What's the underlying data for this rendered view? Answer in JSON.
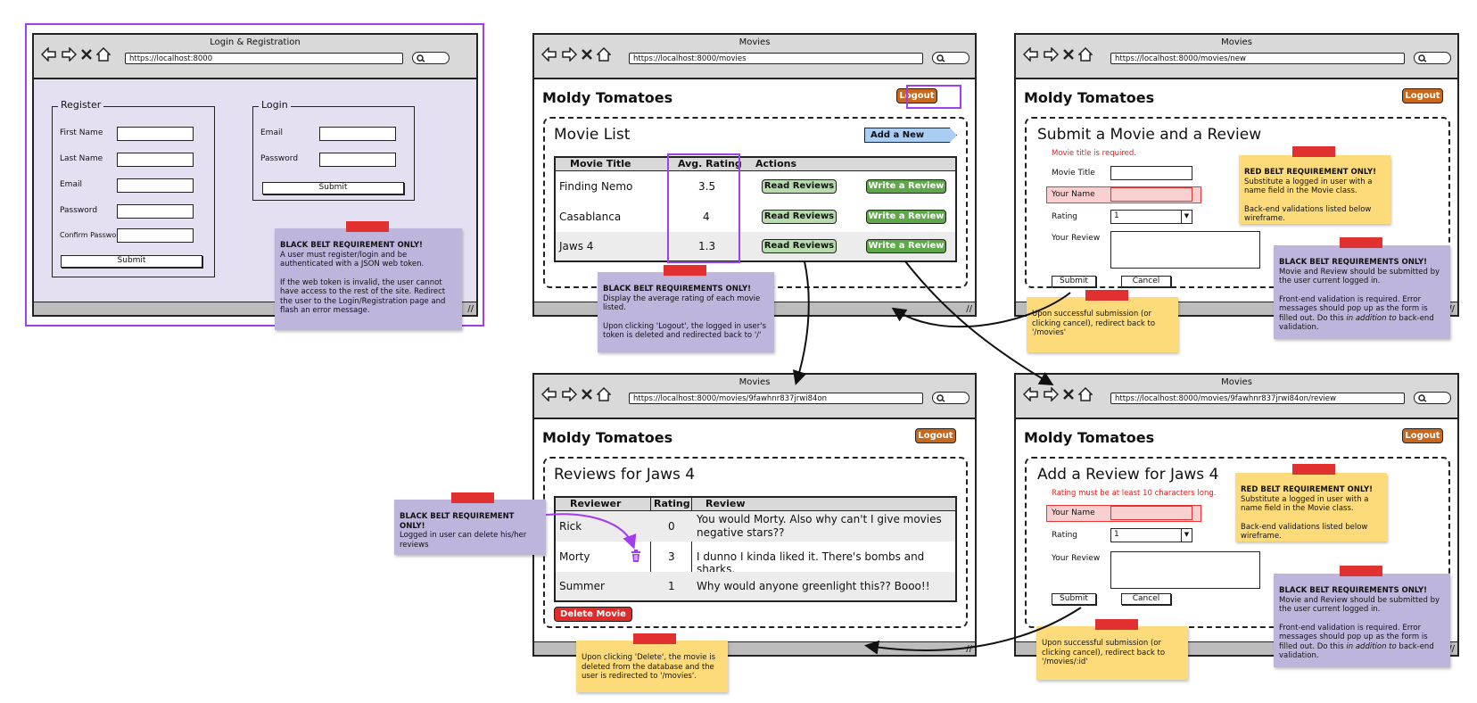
{
  "login_window": {
    "title": "Login & Registration",
    "url": "https://localhost:8000",
    "register": {
      "legend": "Register",
      "fields": [
        "First Name",
        "Last Name",
        "Email",
        "Password",
        "Confirm Password"
      ],
      "submit": "Submit"
    },
    "login": {
      "legend": "Login",
      "fields": [
        "Email",
        "Password"
      ],
      "submit": "Submit"
    },
    "note": {
      "heading": "BLACK BELT REQUIREMENT ONLY!",
      "p1": "A user must register/login and be authenticated with a JSON web token.",
      "p2": "If the web token is invalid, the user cannot have access to the rest of the site. Redirect the user to the Login/Registration page and flash an error message."
    }
  },
  "movies_window": {
    "title": "Movies",
    "url": "https://localhost:8000/movies",
    "brand": "Moldy Tomatoes",
    "logout": "Logout",
    "heading": "Movie List",
    "add_button": "Add a New Movie",
    "columns": [
      "Movie Title",
      "Avg. Rating",
      "Actions"
    ],
    "rows": [
      {
        "title": "Finding Nemo",
        "rating": "3.5"
      },
      {
        "title": "Casablanca",
        "rating": "4"
      },
      {
        "title": "Jaws 4",
        "rating": "1.3"
      }
    ],
    "read_label": "Read Reviews",
    "write_label": "Write a Review",
    "note": {
      "heading": "BLACK BELT REQUIREMENTS ONLY!",
      "p1": "Display the average rating of each movie listed.",
      "p2": "Upon clicking 'Logout', the logged in user's token is deleted and redirected back to '/'"
    }
  },
  "new_window": {
    "title": "Movies",
    "url": "https://localhost:8000/movies/new",
    "brand": "Moldy Tomatoes",
    "logout": "Logout",
    "heading": "Submit a Movie and a Review",
    "error": "Movie title is required.",
    "labels": {
      "movie_title": "Movie Title",
      "your_name": "Your Name",
      "rating": "Rating",
      "your_review": "Your Review"
    },
    "rating_value": "1",
    "submit": "Submit",
    "cancel": "Cancel",
    "red_note": {
      "heading": "RED BELT REQUIREMENT ONLY!",
      "p1": "Substitute a logged in user with a name field in the Movie class.",
      "p2": "Back-end validations listed below wireframe."
    },
    "black_note": {
      "heading": "BLACK BELT REQUIREMENTS ONLY!",
      "p1": "Movie and Review should be submitted by the user current logged in.",
      "p2a": "Front-end validation is required. Error messages should pop up  as the form is filled out. Do this ",
      "p2em": "in addition to",
      "p2b": " back-end validation."
    },
    "redirect_note": "Upon successful submission (or clicking cancel), redirect back to '/movies'"
  },
  "reviews_window": {
    "title": "Movies",
    "url": "https://localhost:8000/movies/9fawhnr837jrwi84on",
    "brand": "Moldy Tomatoes",
    "logout": "Logout",
    "heading": "Reviews for Jaws 4",
    "columns": [
      "Reviewer",
      "Rating",
      "Review"
    ],
    "rows": [
      {
        "reviewer": "Rick",
        "rating": "0",
        "review": "You would Morty. Also why can't I give movies negative stars??"
      },
      {
        "reviewer": "Morty",
        "rating": "3",
        "review": "I dunno I kinda liked it. There's bombs and sharks."
      },
      {
        "reviewer": "Summer",
        "rating": "1",
        "review": "Why would anyone greenlight this?? Booo!!"
      }
    ],
    "delete_button": "Delete Movie",
    "delete_note": "Upon clicking 'Delete', the movie is deleted from the database and the user is redirected to '/movies'.",
    "black_note": {
      "heading": "BLACK BELT REQUIREMENT ONLY!",
      "p1": "Logged in user can delete his/her reviews"
    },
    "trash_color": "#a23ef0"
  },
  "review_window": {
    "title": "Movies",
    "url": "https://localhost:8000/movies/9fawhnr837jrwi84on/review",
    "brand": "Moldy Tomatoes",
    "logout": "Logout",
    "heading": "Add a Review for Jaws 4",
    "error": "Rating must be at least 10 characters long.",
    "labels": {
      "your_name": "Your Name",
      "rating": "Rating",
      "your_review": "Your Review"
    },
    "rating_value": "1",
    "submit": "Submit",
    "cancel": "Cancel",
    "red_note": {
      "heading": "RED BELT REQUIREMENT ONLY!",
      "p1": "Substitute a logged in user with a name field in the Movie class.",
      "p2": "Back-end validations listed below wireframe."
    },
    "black_note": {
      "heading": "BLACK BELT REQUIREMENTS ONLY!",
      "p1": "Movie and Review should be submitted by the user current logged in.",
      "p2a": "Front-end validation is required. Error messages should pop up  as the form is filled out. Do this ",
      "p2em": "in addition to",
      "p2b": " back-end validation."
    },
    "redirect_note": "Upon successful submission (or clicking cancel), redirect back to '/movies/:id'"
  },
  "colors": {
    "highlight": "#a23ef0",
    "lavender_note": "#bdb5dc",
    "yellow_note": "#fddb7a",
    "tape": "#e03030",
    "logout": "#c8681c",
    "add_button": "#a9cdf3",
    "delete_button": "#e02b2b"
  }
}
